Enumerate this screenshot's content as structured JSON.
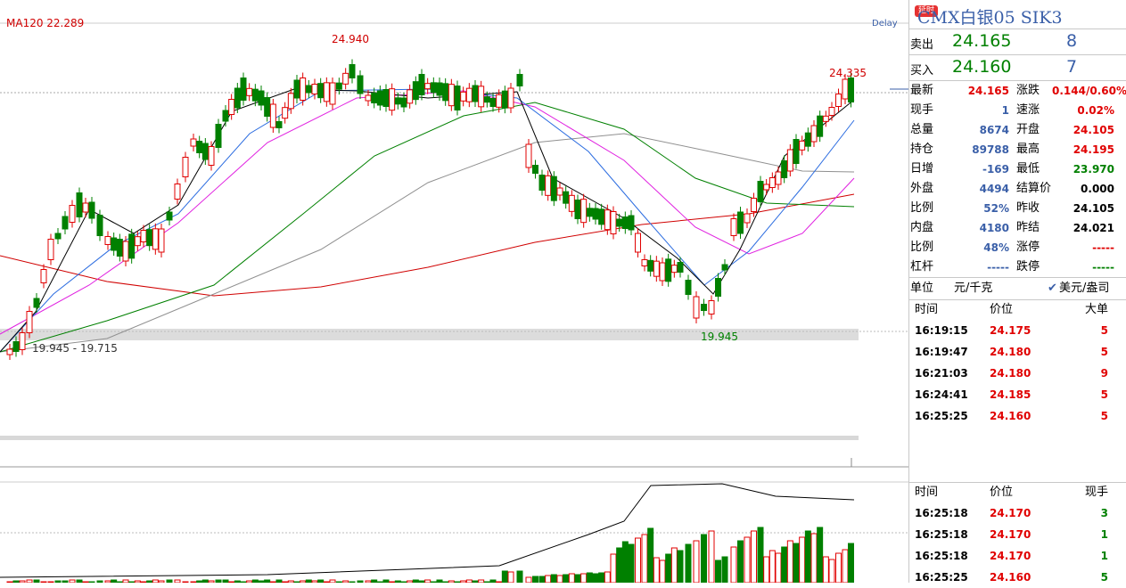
{
  "chart": {
    "ma_label": "MA120  22.289",
    "delay": "Delay",
    "high_label": "24.940",
    "recent_high_label": "24.335",
    "low_label": "19.945",
    "range_label": "19.945 - 19.715"
  },
  "quote": {
    "badge": "延时",
    "title": "CMX白银05  SIK3",
    "sell": {
      "label": "卖出",
      "price": "24.165",
      "qty": "8"
    },
    "buy": {
      "label": "买入",
      "price": "24.160",
      "qty": "7"
    },
    "stats": [
      {
        "l": "最新",
        "v": "24.165",
        "vc": "red",
        "r": "涨跌",
        "rv": "0.144/0.60%",
        "rc": "red"
      },
      {
        "l": "现手",
        "v": "1",
        "vc": "blu",
        "r": "速涨",
        "rv": "0.02%",
        "rc": "red"
      },
      {
        "l": "总量",
        "v": "8674",
        "vc": "blu",
        "r": "开盘",
        "rv": "24.105",
        "rc": "red"
      },
      {
        "l": "持仓",
        "v": "89788",
        "vc": "blu",
        "r": "最高",
        "rv": "24.195",
        "rc": "red"
      },
      {
        "l": "日增",
        "v": "-169",
        "vc": "blu",
        "r": "最低",
        "rv": "23.970",
        "rc": "grn"
      },
      {
        "l": "外盘",
        "v": "4494",
        "vc": "blu",
        "r": "结算价",
        "rv": "0.000",
        "rc": "blk"
      },
      {
        "l": "比例",
        "v": "52%",
        "vc": "blu",
        "r": "昨收",
        "rv": "24.105",
        "rc": "blk"
      },
      {
        "l": "内盘",
        "v": "4180",
        "vc": "blu",
        "r": "昨结",
        "rv": "24.021",
        "rc": "blk"
      },
      {
        "l": "比例",
        "v": "48%",
        "vc": "blu",
        "r": "涨停",
        "rv": "-----",
        "rc": "red"
      },
      {
        "l": "杠杆",
        "v": "-----",
        "vc": "blu",
        "r": "跌停",
        "rv": "-----",
        "rc": "grn"
      }
    ],
    "unit_label": "单位",
    "unit_value": "元/千克",
    "alt_unit": "美元/盎司",
    "trades_big": {
      "headers": [
        "时间",
        "价位",
        "大单"
      ],
      "rows": [
        [
          "16:19:15",
          "24.175",
          "5"
        ],
        [
          "16:19:47",
          "24.180",
          "5"
        ],
        [
          "16:21:03",
          "24.180",
          "9"
        ],
        [
          "16:24:41",
          "24.185",
          "5"
        ],
        [
          "16:25:25",
          "24.160",
          "5"
        ]
      ]
    },
    "trades": {
      "headers": [
        "时间",
        "价位",
        "现手"
      ],
      "rows": [
        [
          "16:25:18",
          "24.170",
          "3"
        ],
        [
          "16:25:18",
          "24.170",
          "1"
        ],
        [
          "16:25:18",
          "24.170",
          "1"
        ],
        [
          "16:25:25",
          "24.160",
          "5"
        ]
      ]
    }
  },
  "colors": {
    "up": "#e00000",
    "down": "#008000",
    "ma5": "#000000",
    "ma10": "#2b6ce0",
    "ma20": "#e020e0",
    "ma40": "#008000",
    "ma60": "#909090",
    "ma120": "#d00000"
  }
}
